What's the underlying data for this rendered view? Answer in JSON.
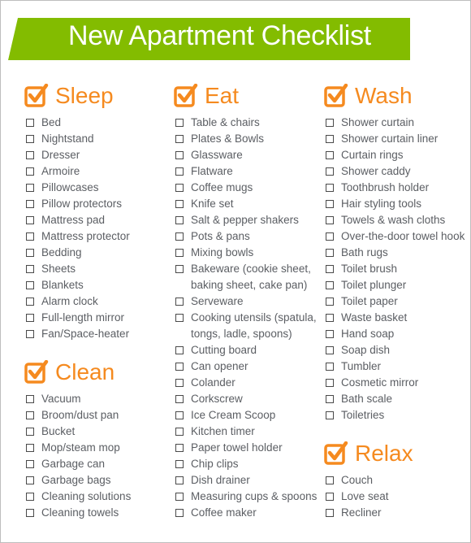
{
  "title": "New Apartment Checklist",
  "colors": {
    "banner": "#83bc00",
    "accent": "#f58a1f",
    "text": "#5b5e63"
  },
  "icons": {
    "banner": "checkbox-checked-icon",
    "section": "checkbox-checked-icon",
    "item": "checkbox-empty-icon"
  },
  "sections": {
    "sleep": {
      "title": "Sleep",
      "items": [
        "Bed",
        "Nightstand",
        "Dresser",
        "Armoire",
        "Pillowcases",
        "Pillow protectors",
        "Mattress pad",
        "Mattress protector",
        "Bedding",
        "Sheets",
        "Blankets",
        "Alarm clock",
        "Full-length mirror",
        "Fan/Space-heater"
      ]
    },
    "clean": {
      "title": "Clean",
      "items": [
        "Vacuum",
        "Broom/dust pan",
        "Bucket",
        "Mop/steam mop",
        "Garbage can",
        "Garbage bags",
        "Cleaning solutions",
        "Cleaning towels"
      ]
    },
    "eat": {
      "title": "Eat",
      "items": [
        "Table & chairs",
        "Plates & Bowls",
        "Glassware",
        "Flatware",
        "Coffee mugs",
        "Knife set",
        "Salt & pepper shakers",
        "Pots & pans",
        "Mixing bowls",
        "Bakeware (cookie sheet,\nbaking sheet, cake pan)",
        "Serveware",
        "Cooking utensils (spatula,\ntongs, ladle, spoons)",
        "Cutting board",
        "Can opener",
        "Colander",
        "Corkscrew",
        "Ice Cream Scoop",
        "Kitchen timer",
        "Paper towel holder",
        "Chip clips",
        "Dish drainer",
        "Measuring cups & spoons",
        "Coffee maker"
      ]
    },
    "wash": {
      "title": "Wash",
      "items": [
        "Shower curtain",
        "Shower curtain liner",
        "Curtain rings",
        "Shower caddy",
        "Toothbrush holder",
        "Hair styling tools",
        "Towels & wash cloths",
        "Over-the-door towel hook",
        "Bath rugs",
        "Toilet brush",
        "Toilet plunger",
        "Toilet paper",
        "Waste basket",
        "Hand soap",
        "Soap dish",
        "Tumbler",
        "Cosmetic mirror",
        "Bath scale",
        "Toiletries"
      ]
    },
    "relax": {
      "title": "Relax",
      "items": [
        "Couch",
        "Love seat",
        "Recliner"
      ]
    }
  }
}
